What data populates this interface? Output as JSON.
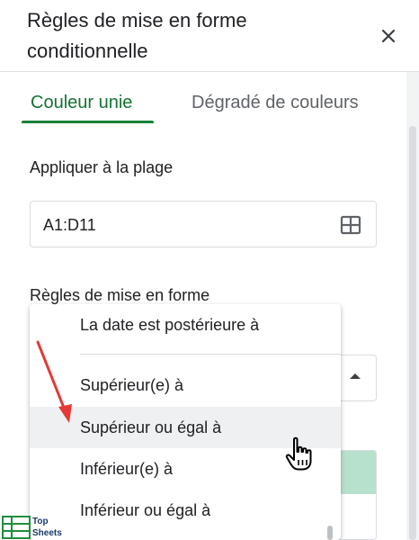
{
  "panel": {
    "title": "Règles de mise en forme conditionnelle"
  },
  "tabs": [
    {
      "label": "Couleur unie",
      "active": true
    },
    {
      "label": "Dégradé de couleurs",
      "active": false
    }
  ],
  "range": {
    "label": "Appliquer à la plage",
    "value": "A1:D11"
  },
  "rules": {
    "label": "Règles de mise en forme"
  },
  "dropdown": {
    "items": [
      {
        "label": "La date est postérieure à"
      },
      {
        "label": "Supérieur(e) à"
      },
      {
        "label": "Supérieur ou égal à",
        "hovered": true
      },
      {
        "label": "Inférieur(e) à"
      },
      {
        "label": "Inférieur ou égal à"
      }
    ]
  },
  "colors": {
    "accent": "#188038",
    "accent_text": "#137333",
    "preview_fill": "#b7e1cd",
    "arrow": "#e53935",
    "hover": "#eef0f2"
  },
  "icons": {
    "close": "close-icon",
    "range_picker": "grid-icon",
    "select_caret": "caret-up-icon",
    "cursor": "hand-pointer-icon"
  },
  "watermark": {
    "line1": "Top",
    "line2": "Sheets"
  }
}
